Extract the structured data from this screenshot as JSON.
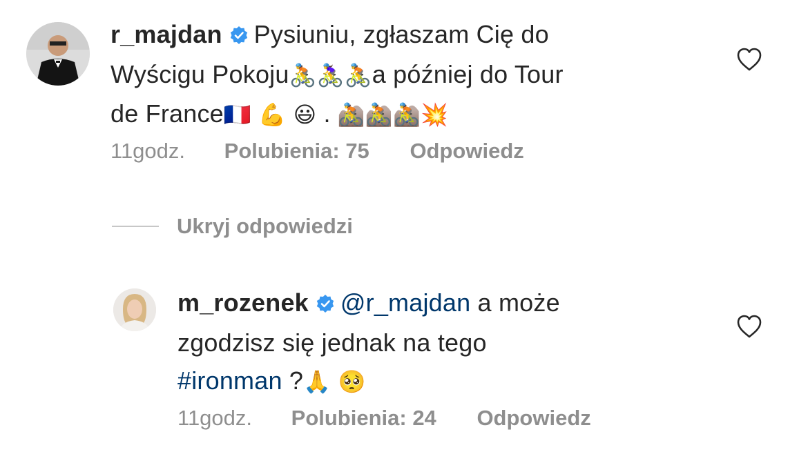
{
  "comments": [
    {
      "username": "r_majdan",
      "line1_text": "Pysiuniu, zgłaszam Cię do",
      "line2_text": "Wyścigu Pokoju",
      "line2_emoji": "🚴🚴‍♀️🚴",
      "line2_tail": "a później do Tour",
      "line3_text": "de France",
      "line3_emoji": "🇫🇷 💪 😃",
      "line3_dot": ".",
      "line3_emoji2": "🚵🚵🚵💥",
      "time": "11godz.",
      "likes": "Polubienia: 75",
      "reply": "Odpowiedz",
      "verified_icon": "verified-badge-icon",
      "like_icon": "heart-outline-icon"
    },
    {
      "username": "m_rozenek",
      "mention": "@r_majdan",
      "line1_tail": "a może",
      "line2_text": "zgodzisz się jednak na tego",
      "hashtag": "#ironman",
      "line3_tail": "?",
      "line3_emoji": "🙏 🥺",
      "time": "11godz.",
      "likes": "Polubienia: 24",
      "reply": "Odpowiedz",
      "verified_icon": "verified-badge-icon",
      "like_icon": "heart-outline-icon"
    }
  ],
  "hide_replies": "Ukryj odpowiedzi",
  "colors": {
    "text": "#262626",
    "secondary": "#8e8e8e",
    "link": "#00376b",
    "verified": "#3897f0"
  }
}
